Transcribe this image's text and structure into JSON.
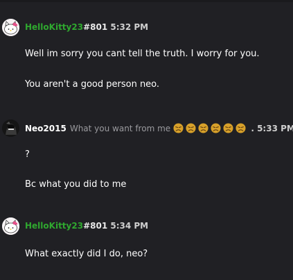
{
  "messages": [
    {
      "username": "HelloKitty23",
      "tag": "#801",
      "time": "5:32 PM",
      "lines": [
        "Well im sorry you cant tell the truth. I worry for you.",
        "You aren't a good person neo."
      ]
    },
    {
      "username": "Neo2015",
      "status": "What you want from me",
      "time": ". 5:33 PM",
      "emoji_count": 6,
      "lines": [
        "?",
        "Bc what you did to me"
      ]
    },
    {
      "username": "HelloKitty23",
      "tag": "#801",
      "time": "5:34 PM",
      "lines": [
        "What exactly did I do, neo?"
      ]
    }
  ],
  "colors": {
    "background": "#202024",
    "kitty_name": "#2fa82f",
    "neo_name": "#ffffff",
    "status": "#9a9a9e"
  },
  "icons": {
    "kitty_avatar": "hello-kitty-icon",
    "neo_avatar": "dark-character-icon",
    "status_emoji": "disappointed-face-emoji"
  }
}
